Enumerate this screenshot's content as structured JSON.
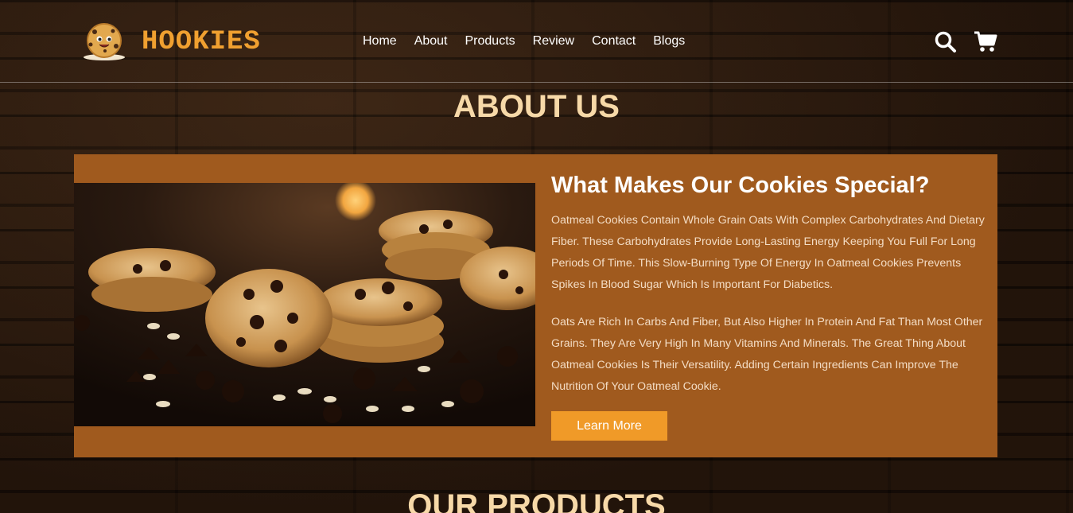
{
  "brand": {
    "name": "HOOKIES",
    "accent_color": "#f0a030"
  },
  "nav": {
    "items": [
      "Home",
      "About",
      "Products",
      "Review",
      "Contact",
      "Blogs"
    ]
  },
  "header_icons": {
    "search": "search-icon",
    "cart": "cart-icon"
  },
  "about": {
    "section_title": "ABOUT US",
    "heading": "What Makes Our Cookies Special?",
    "paragraphs": [
      "Oatmeal Cookies Contain Whole Grain Oats With Complex Carbohydrates And Dietary Fiber. These Carbohydrates Provide Long-Lasting Energy Keeping You Full For Long Periods Of Time. This Slow-Burning Type Of Energy In Oatmeal Cookies Prevents Spikes In Blood Sugar Which Is Important For Diabetics.",
      "Oats Are Rich In Carbs And Fiber, But Also Higher In Protein And Fat Than Most Other Grains. They Are Very High In Many Vitamins And Minerals. The Great Thing About Oatmeal Cookies Is Their Versatility. Adding Certain Ingredients Can Improve The Nutrition Of Your Oatmeal Cookie."
    ],
    "button_label": "Learn More",
    "card_color": "#a05a1e",
    "button_color": "#f09a28"
  },
  "products": {
    "section_title": "OUR PRODUCTS"
  }
}
